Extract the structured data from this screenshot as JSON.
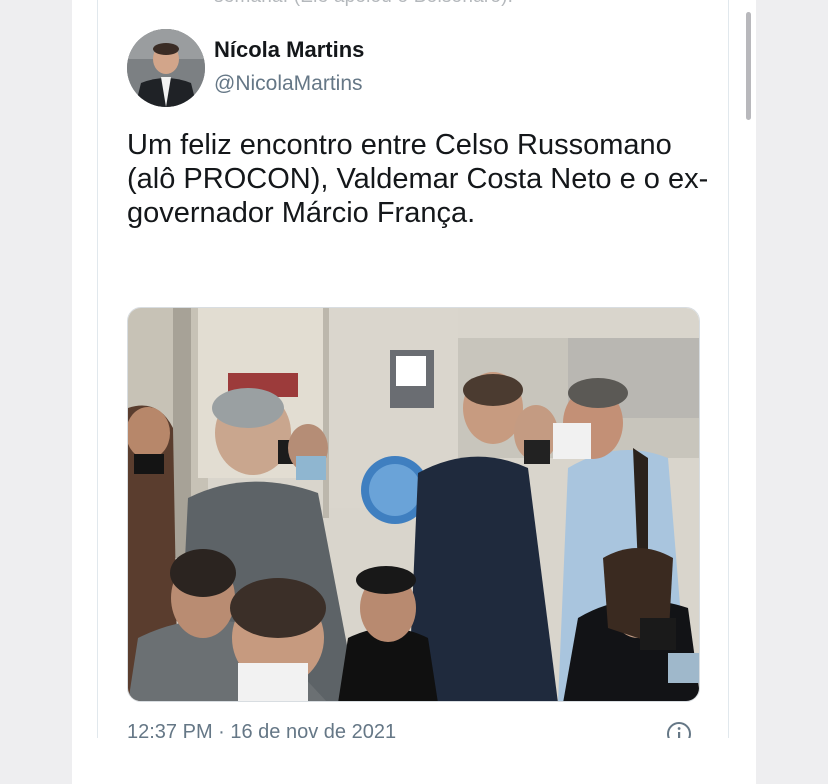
{
  "quoted_fragment": "semana. (Ele apoiou o Bolsonaro).",
  "author": {
    "name": "Nícola Martins",
    "handle": "@NicolaMartins"
  },
  "tweet": {
    "text": "Um feliz encontro entre Celso Russomano (alô PROCON), Valdemar Costa Neto e o ex-governador Márcio França."
  },
  "timestamp": "12:37 PM · 16 de nov de 2021",
  "icons": {
    "info": "info-icon",
    "avatar": "avatar"
  },
  "colors": {
    "text": "#14171a",
    "secondary": "#657786",
    "border": "#e1e8ed"
  }
}
